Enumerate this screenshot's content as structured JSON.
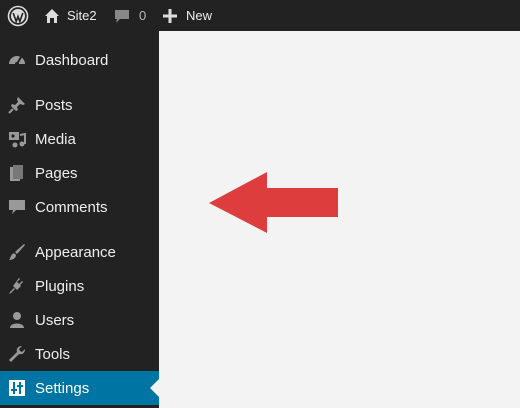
{
  "adminbar": {
    "site_name": "Site2",
    "comment_count": "0",
    "new_label": "New"
  },
  "menu": {
    "items": [
      {
        "label": "Dashboard",
        "icon": "dashboard-icon"
      },
      {
        "label": "Posts",
        "icon": "pushpin-icon"
      },
      {
        "label": "Media",
        "icon": "media-icon"
      },
      {
        "label": "Pages",
        "icon": "pages-icon"
      },
      {
        "label": "Comments",
        "icon": "comment-icon"
      },
      {
        "label": "Appearance",
        "icon": "brush-icon"
      },
      {
        "label": "Plugins",
        "icon": "plugin-icon"
      },
      {
        "label": "Users",
        "icon": "user-icon"
      },
      {
        "label": "Tools",
        "icon": "wrench-icon"
      },
      {
        "label": "Settings",
        "icon": "settings-sliders-icon",
        "current": true
      }
    ]
  },
  "colors": {
    "sidebar_bg": "#222222",
    "current_bg": "#0074a2",
    "content_bg": "#f3f3f3",
    "arrow": "#dd3d3d"
  }
}
